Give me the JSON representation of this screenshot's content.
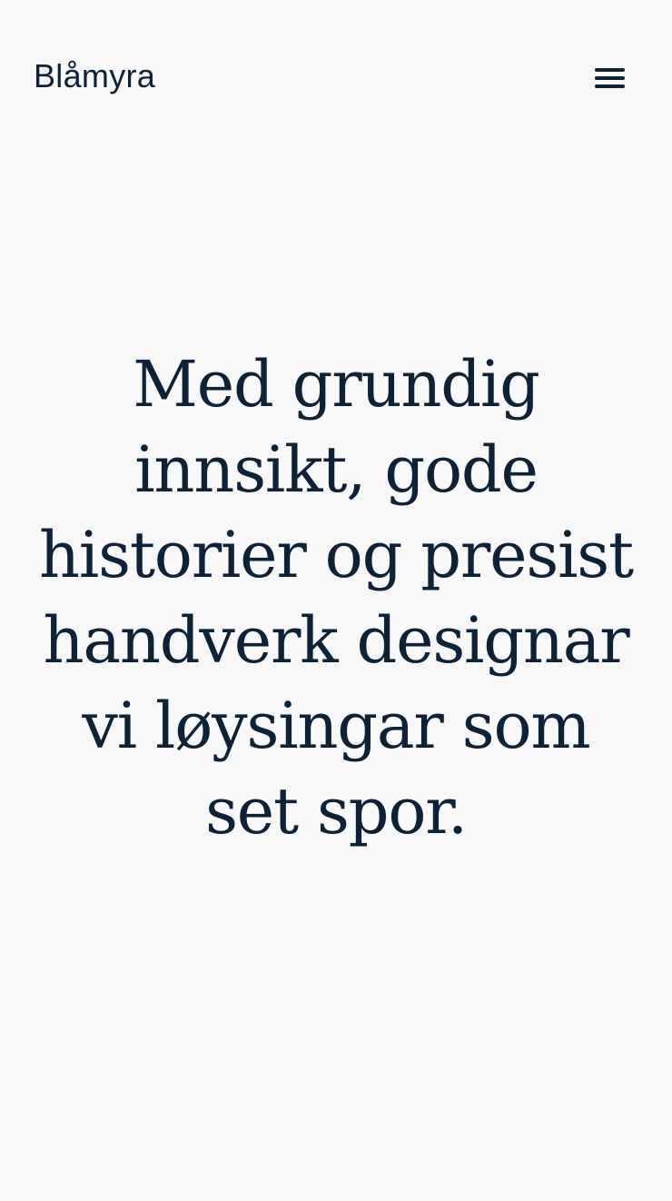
{
  "header": {
    "logo_text": "Blåmyra",
    "menu_icon": "hamburger-menu-icon"
  },
  "hero": {
    "headline": "Med grundig innsikt, gode historier og presist handverk designar vi løysingar som set spor."
  },
  "colors": {
    "background": "#f8f8f8",
    "text": "#0d2137"
  }
}
